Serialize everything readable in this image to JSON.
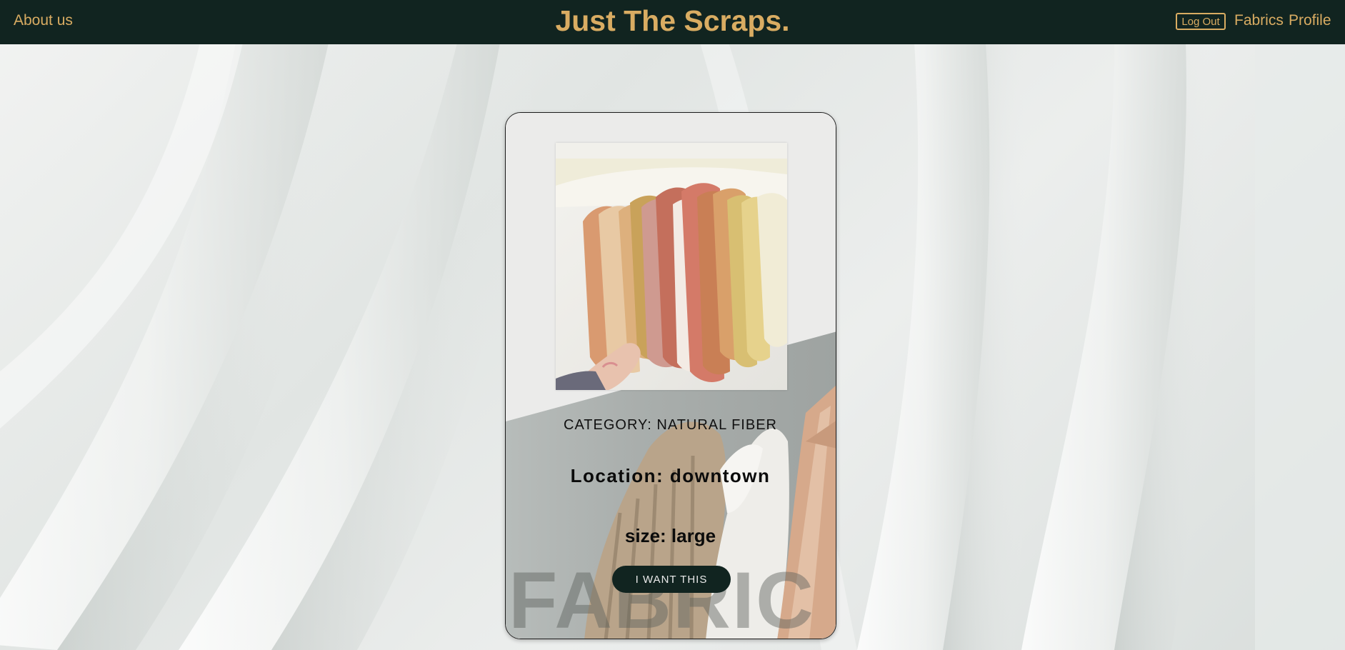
{
  "header": {
    "about_label": "About us",
    "title": "Just The Scraps.",
    "logout_label": "Log Out",
    "fabrics_label": "Fabrics",
    "profile_label": "Profile"
  },
  "card": {
    "image_icon": "fabric-scraps-photo",
    "watermark": "FABRIC",
    "category": "CATEGORY: NATURAL FIBER",
    "location": "Location: downtown",
    "size": "size: large",
    "action_label": "I WANT THIS"
  },
  "colors": {
    "navbar": "#112420",
    "accent_gold": "#d9ac62",
    "button": "#112420"
  }
}
